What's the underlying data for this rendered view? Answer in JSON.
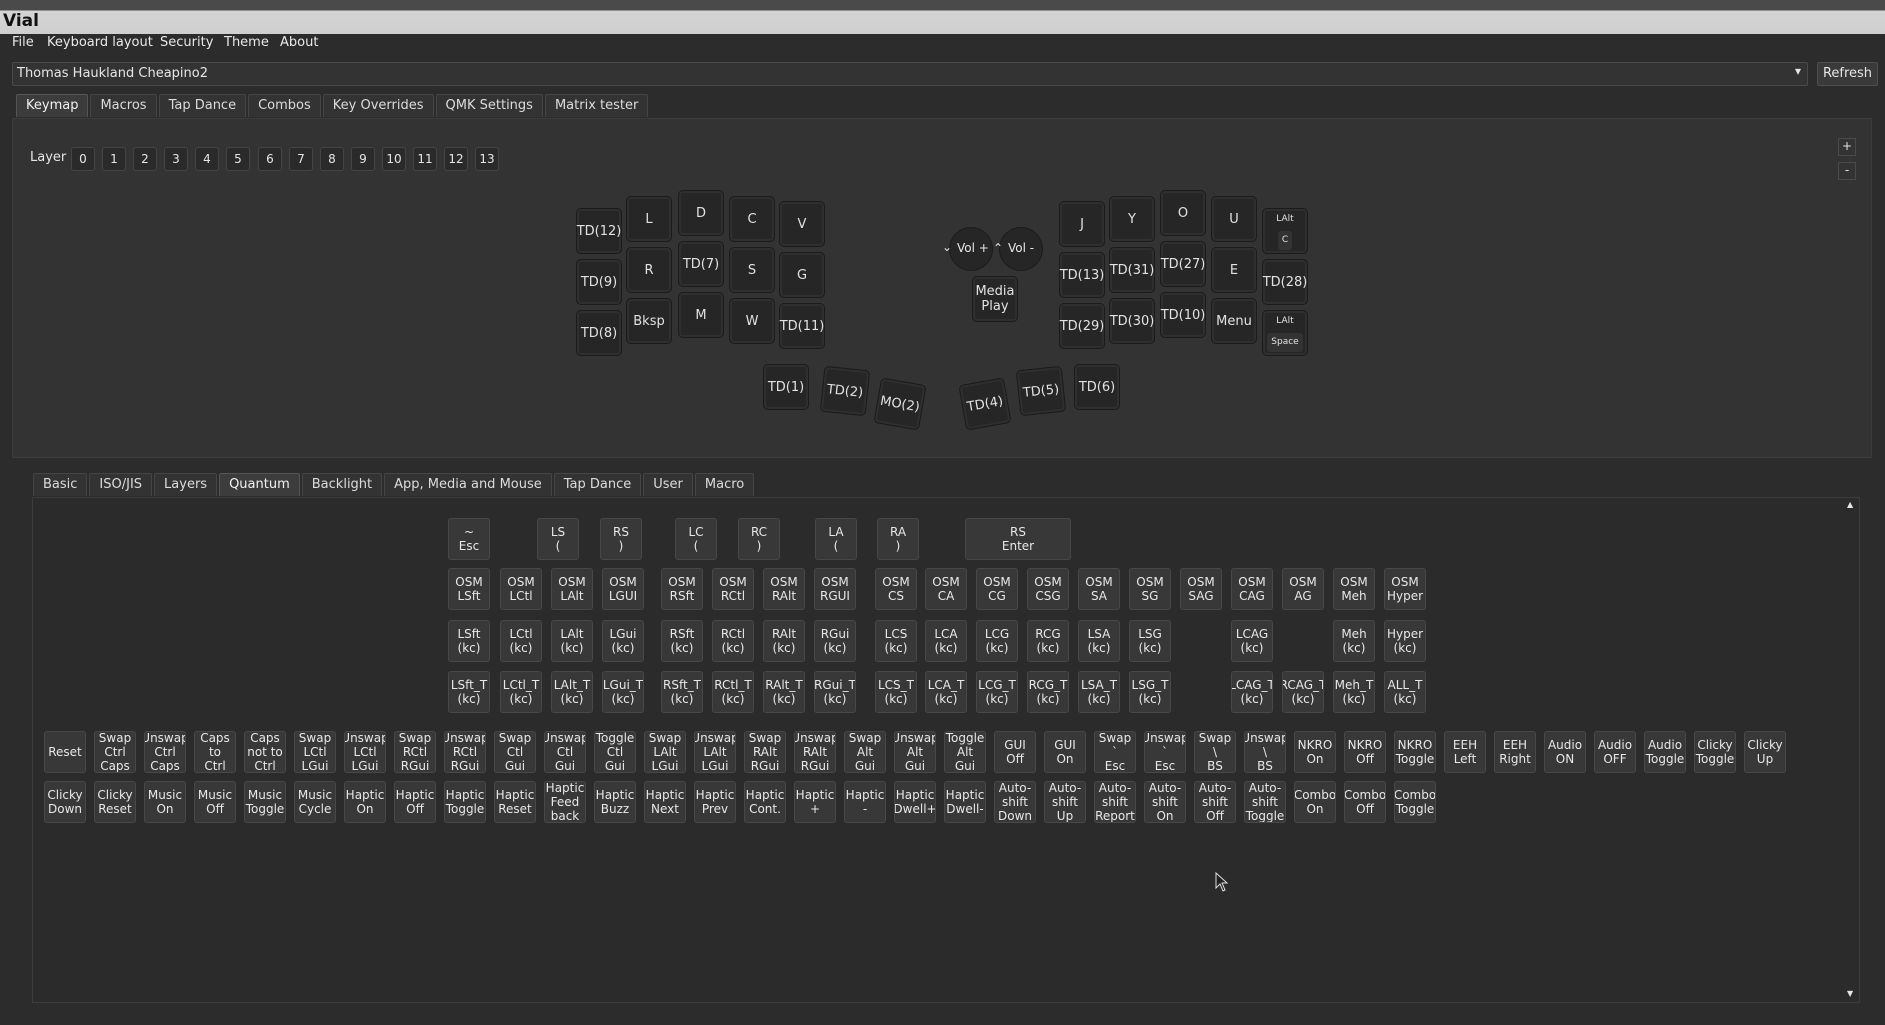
{
  "app": {
    "title": "Vial"
  },
  "menu": [
    "File",
    "Keyboard layout",
    "Security",
    "Theme",
    "About"
  ],
  "device": {
    "selected": "Thomas Haukland Cheapino2",
    "refresh_label": "Refresh"
  },
  "main_tabs": [
    "Keymap",
    "Macros",
    "Tap Dance",
    "Combos",
    "Key Overrides",
    "QMK Settings",
    "Matrix tester"
  ],
  "layers": {
    "label": "Layer",
    "items": [
      "0",
      "1",
      "2",
      "3",
      "4",
      "5",
      "6",
      "7",
      "8",
      "9",
      "10",
      "11",
      "12",
      "13"
    ],
    "selected": "0"
  },
  "zoom": {
    "plus": "+",
    "minus": "-"
  },
  "keyboard": {
    "keys": [
      "TD(12)",
      "L",
      "D",
      "C",
      "V",
      "TD(9)",
      "R",
      "TD(7)",
      "S",
      "G",
      "TD(8)",
      "Bksp",
      "M",
      "W",
      "TD(11)",
      "J",
      "Y",
      "O",
      "U",
      "TD(13)",
      "TD(31)",
      "TD(27)",
      "E",
      "TD(28)",
      "TD(29)",
      "TD(30)",
      "TD(10)",
      "Menu",
      "TD(1)",
      "TD(2)",
      "MO(2)",
      "TD(4)",
      "TD(5)",
      "TD(6)",
      "Media\nPlay"
    ],
    "dual": [
      {
        "top": "LAlt",
        "bottom": "C"
      },
      {
        "top": "LAlt",
        "bottom": "Space"
      }
    ],
    "encoder": {
      "left": "Vol +",
      "right": "Vol -",
      "left_arrow": "⌄",
      "right_arrow": "⌃"
    }
  },
  "category_tabs": [
    "Basic",
    "ISO/JIS",
    "Layers",
    "Quantum",
    "Backlight",
    "App, Media and Mouse",
    "Tap Dance",
    "User",
    "Macro"
  ],
  "quantum": {
    "row0": [
      "~\nEsc",
      "LS\n(",
      "RS\n)",
      "LC\n(",
      "RC\n)",
      "LA\n(",
      "RA\n)",
      "RS\nEnter"
    ],
    "row1": [
      "OSM\nLSft",
      "OSM\nLCtl",
      "OSM\nLAlt",
      "OSM\nLGUI",
      "OSM\nRSft",
      "OSM\nRCtl",
      "OSM\nRAlt",
      "OSM\nRGUI",
      "OSM\nCS",
      "OSM\nCA",
      "OSM\nCG",
      "OSM\nCSG",
      "OSM\nSA",
      "OSM\nSG",
      "OSM\nSAG",
      "OSM\nCAG",
      "OSM\nAG",
      "OSM\nMeh",
      "OSM\nHyper"
    ],
    "row2": [
      "LSft\n(kc)",
      "LCtl\n(kc)",
      "LAlt\n(kc)",
      "LGui\n(kc)",
      "RSft\n(kc)",
      "RCtl\n(kc)",
      "RAlt\n(kc)",
      "RGui\n(kc)",
      "LCS\n(kc)",
      "LCA\n(kc)",
      "LCG\n(kc)",
      "RCG\n(kc)",
      "LSA\n(kc)",
      "LSG\n(kc)",
      "LCAG\n(kc)",
      "Meh\n(kc)",
      "Hyper\n(kc)"
    ],
    "row3": [
      "LSft_T\n(kc)",
      "LCtl_T\n(kc)",
      "LAlt_T\n(kc)",
      "LGui_T\n(kc)",
      "RSft_T\n(kc)",
      "RCtl_T\n(kc)",
      "RAlt_T\n(kc)",
      "RGui_T\n(kc)",
      "LCS_T\n(kc)",
      "LCA_T\n(kc)",
      "LCG_T\n(kc)",
      "RCG_T\n(kc)",
      "LSA_T\n(kc)",
      "LSG_T\n(kc)",
      "LCAG_T\n(kc)",
      "RCAG_T\n(kc)",
      "Meh_T\n(kc)",
      "ALL_T\n(kc)"
    ],
    "row4": [
      "Reset",
      "Swap\nCtrl\nCaps",
      "Unswap\nCtrl\nCaps",
      "Caps\nto\nCtrl",
      "Caps\nnot to\nCtrl",
      "Swap\nLCtl\nLGui",
      "Unswap\nLCtl\nLGui",
      "Swap\nRCtl\nRGui",
      "Unswap\nRCtl\nRGui",
      "Swap\nCtl\nGui",
      "Unswap\nCtl\nGui",
      "Toggle\nCtl\nGui",
      "Swap\nLAlt\nLGui",
      "Unswap\nLAlt\nLGui",
      "Swap\nRAlt\nRGui",
      "Unswap\nRAlt\nRGui",
      "Swap\nAlt\nGui",
      "Unswap\nAlt\nGui",
      "Toggle\nAlt\nGui",
      "GUI\nOff",
      "GUI\nOn",
      "Swap\n`\nEsc",
      "Unswap\n`\nEsc",
      "Swap\n\\\nBS",
      "Unswap\n\\\nBS",
      "NKRO\nOn",
      "NKRO\nOff",
      "NKRO\nToggle",
      "EEH\nLeft",
      "EEH\nRight",
      "Audio\nON",
      "Audio\nOFF",
      "Audio\nToggle",
      "Clicky\nToggle",
      "Clicky\nUp"
    ],
    "row5": [
      "Clicky\nDown",
      "Clicky\nReset",
      "Music\nOn",
      "Music\nOff",
      "Music\nToggle",
      "Music\nCycle",
      "Haptic\nOn",
      "Haptic\nOff",
      "Haptic\nToggle",
      "Haptic\nReset",
      "Haptic\nFeed\nback",
      "Haptic\nBuzz",
      "Haptic\nNext",
      "Haptic\nPrev",
      "Haptic\nCont.",
      "Haptic\n+",
      "Haptic\n-",
      "Haptic\nDwell+",
      "Haptic\nDwell-",
      "Auto-\nshift\nDown",
      "Auto-\nshift\nUp",
      "Auto-\nshift\nReport",
      "Auto-\nshift\nOn",
      "Auto-\nshift\nOff",
      "Auto-\nshift\nToggle",
      "Combo\nOn",
      "Combo\nOff",
      "Combo\nToggle"
    ]
  },
  "colors": {
    "background": "#2c2c2c",
    "key": "#262626",
    "button": "#383838",
    "titlebar": "#d4d4d4"
  }
}
